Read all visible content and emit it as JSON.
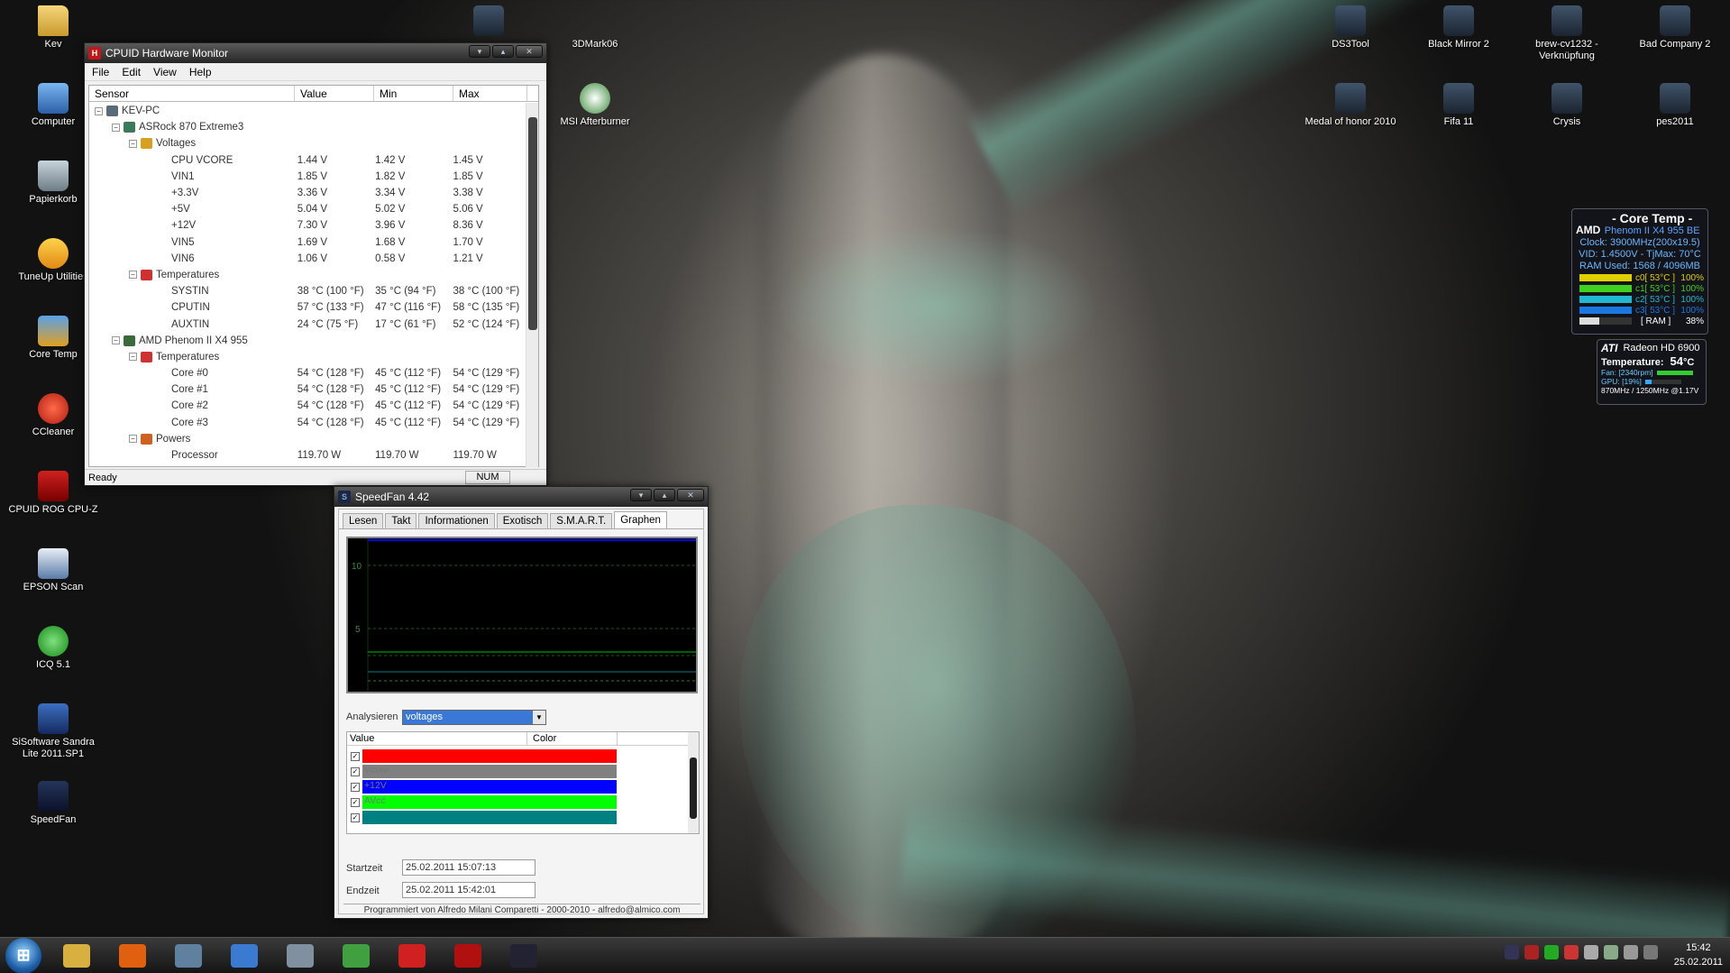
{
  "desktop": {
    "left_icons": [
      {
        "label": "Kev",
        "icon": "folder-icon"
      },
      {
        "label": "Computer",
        "icon": "computer-icon"
      },
      {
        "label": "Papierkorb",
        "icon": "recycle-bin-icon"
      },
      {
        "label": "TuneUp Utilities",
        "icon": "tuneup-icon"
      },
      {
        "label": "Core Temp",
        "icon": "coretemp-icon"
      },
      {
        "label": "CCleaner",
        "icon": "ccleaner-icon"
      },
      {
        "label": "CPUID ROG CPU-Z",
        "icon": "cpuz-icon"
      },
      {
        "label": "EPSON Scan",
        "icon": "epson-icon"
      },
      {
        "label": "ICQ 5.1",
        "icon": "icq-icon"
      },
      {
        "label": "SiSoftware Sandra Lite 2011.SP1",
        "icon": "sandra-icon"
      },
      {
        "label": "SpeedFan",
        "icon": "speedfan-icon"
      }
    ],
    "mid_icons": [
      {
        "label": "3DMark06",
        "icon": "3dmark-icon"
      },
      {
        "label": "MSI Afterburner",
        "icon": "afterburner-icon"
      }
    ],
    "right_icons": [
      {
        "label": "DS3Tool",
        "icon": "ds3tool-icon"
      },
      {
        "label": "Black Mirror 2",
        "icon": "game-icon"
      },
      {
        "label": "brew-cv1232 - Verknüpfung",
        "icon": "shortcut-icon"
      },
      {
        "label": "Bad Company 2",
        "icon": "game-icon"
      },
      {
        "label": "Medal of honor 2010",
        "icon": "game-icon"
      },
      {
        "label": "Fifa 11",
        "icon": "game-icon"
      },
      {
        "label": "Crysis",
        "icon": "game-icon"
      },
      {
        "label": "pes2011",
        "icon": "game-icon"
      }
    ]
  },
  "cpuid": {
    "title": "CPUID Hardware Monitor",
    "menu": [
      "File",
      "Edit",
      "View",
      "Help"
    ],
    "columns": [
      "Sensor",
      "Value",
      "Min",
      "Max"
    ],
    "rows": [
      {
        "indent": 0,
        "expander": "-",
        "label": "KEV-PC",
        "value": "",
        "min": "",
        "max": "",
        "kind": "pc"
      },
      {
        "indent": 1,
        "expander": "-",
        "label": "ASRock 870 Extreme3",
        "value": "",
        "min": "",
        "max": "",
        "kind": "board"
      },
      {
        "indent": 2,
        "expander": "-",
        "label": "Voltages",
        "value": "",
        "min": "",
        "max": "",
        "kind": "volt"
      },
      {
        "indent": 3,
        "expander": "",
        "label": "CPU VCORE",
        "value": "1.44 V",
        "min": "1.42 V",
        "max": "1.45 V"
      },
      {
        "indent": 3,
        "expander": "",
        "label": "VIN1",
        "value": "1.85 V",
        "min": "1.82 V",
        "max": "1.85 V"
      },
      {
        "indent": 3,
        "expander": "",
        "label": "+3.3V",
        "value": "3.36 V",
        "min": "3.34 V",
        "max": "3.38 V"
      },
      {
        "indent": 3,
        "expander": "",
        "label": "+5V",
        "value": "5.04 V",
        "min": "5.02 V",
        "max": "5.06 V"
      },
      {
        "indent": 3,
        "expander": "",
        "label": "+12V",
        "value": "7.30 V",
        "min": "3.96 V",
        "max": "8.36 V"
      },
      {
        "indent": 3,
        "expander": "",
        "label": "VIN5",
        "value": "1.69 V",
        "min": "1.68 V",
        "max": "1.70 V"
      },
      {
        "indent": 3,
        "expander": "",
        "label": "VIN6",
        "value": "1.06 V",
        "min": "0.58 V",
        "max": "1.21 V"
      },
      {
        "indent": 2,
        "expander": "-",
        "label": "Temperatures",
        "value": "",
        "min": "",
        "max": "",
        "kind": "temp"
      },
      {
        "indent": 3,
        "expander": "",
        "label": "SYSTIN",
        "value": "38 °C (100 °F)",
        "min": "35 °C (94 °F)",
        "max": "38 °C (100 °F)"
      },
      {
        "indent": 3,
        "expander": "",
        "label": "CPUTIN",
        "value": "57 °C (133 °F)",
        "min": "47 °C (116 °F)",
        "max": "58 °C (135 °F)"
      },
      {
        "indent": 3,
        "expander": "",
        "label": "AUXTIN",
        "value": "24 °C (75 °F)",
        "min": "17 °C (61 °F)",
        "max": "52 °C (124 °F)"
      },
      {
        "indent": 1,
        "expander": "-",
        "label": "AMD Phenom II X4 955",
        "value": "",
        "min": "",
        "max": "",
        "kind": "cpu"
      },
      {
        "indent": 2,
        "expander": "-",
        "label": "Temperatures",
        "value": "",
        "min": "",
        "max": "",
        "kind": "temp"
      },
      {
        "indent": 3,
        "expander": "",
        "label": "Core #0",
        "value": "54 °C (128 °F)",
        "min": "45 °C (112 °F)",
        "max": "54 °C (129 °F)"
      },
      {
        "indent": 3,
        "expander": "",
        "label": "Core #1",
        "value": "54 °C (128 °F)",
        "min": "45 °C (112 °F)",
        "max": "54 °C (129 °F)"
      },
      {
        "indent": 3,
        "expander": "",
        "label": "Core #2",
        "value": "54 °C (128 °F)",
        "min": "45 °C (112 °F)",
        "max": "54 °C (129 °F)"
      },
      {
        "indent": 3,
        "expander": "",
        "label": "Core #3",
        "value": "54 °C (128 °F)",
        "min": "45 °C (112 °F)",
        "max": "54 °C (129 °F)"
      },
      {
        "indent": 2,
        "expander": "-",
        "label": "Powers",
        "value": "",
        "min": "",
        "max": "",
        "kind": "power"
      },
      {
        "indent": 3,
        "expander": "",
        "label": "Processor",
        "value": "119.70 W",
        "min": "119.70 W",
        "max": "119.70 W"
      }
    ],
    "status": "Ready",
    "num_indicator": "NUM"
  },
  "speedfan": {
    "title": "SpeedFan 4.42",
    "tabs": [
      "Lesen",
      "Takt",
      "Informationen",
      "Exotisch",
      "S.M.A.R.T.",
      "Graphen"
    ],
    "active_tab": "Graphen",
    "graph_y_labels": [
      "10",
      "5"
    ],
    "analyze_label": "Analysieren",
    "analyze_value": "voltages",
    "list_columns": [
      "Value",
      "Color"
    ],
    "series": [
      {
        "name": "",
        "color": "#ff0000"
      },
      {
        "name": "Vcore",
        "color": "#808080"
      },
      {
        "name": "+12V",
        "color": "#0000ff"
      },
      {
        "name": "AVcc",
        "color": "#00ff00"
      },
      {
        "name": "",
        "color": "#008080"
      }
    ],
    "start_label": "Startzeit",
    "start_value": "25.02.2011 15:07:13",
    "end_label": "Endzeit",
    "end_value": "25.02.2011 15:42:01",
    "footer": "Programmiert von Alfredo Milani Comparetti - 2000-2010 - alfredo@almico.com"
  },
  "coretemp_gadget": {
    "title": "- Core Temp -",
    "brand": "AMD",
    "cpu": "Phenom II X4 955 BE",
    "clock": "Clock: 3900MHz(200x19.5)",
    "vid": "VID: 1.4500V - TjMax: 70°C",
    "ram": "RAM Used: 1568 / 4096MB",
    "cores": [
      {
        "label": "c0[ 53°C ]",
        "load": "100%",
        "color": "#e0d000"
      },
      {
        "label": "c1[ 53°C ]",
        "load": "100%",
        "color": "#40d020"
      },
      {
        "label": "c2[ 53°C ]",
        "load": "100%",
        "color": "#20b8d0"
      },
      {
        "label": "c3[ 53°C ]",
        "load": "100%",
        "color": "#1a78e0"
      }
    ],
    "ram_label": "[ RAM ]",
    "ram_pct": "38%",
    "ram_fraction": 0.38
  },
  "ati_gadget": {
    "brand": "ATI",
    "model": "Radeon HD 6900",
    "temp_label": "Temperature:",
    "temp_value": "54",
    "temp_unit": "°C",
    "fan": "Fan: [2340rpm]",
    "gpu": "GPU: [19%]",
    "clocks": "870MHz / 1250MHz @1.17V"
  },
  "taskbar": {
    "apps": [
      {
        "name": "explorer",
        "color": "#d8b040"
      },
      {
        "name": "firefox",
        "color": "#e06010"
      },
      {
        "name": "monitor",
        "color": "#6080a0"
      },
      {
        "name": "thunderbird",
        "color": "#3a7ad0"
      },
      {
        "name": "speedfan-gear",
        "color": "#8090a0"
      },
      {
        "name": "messenger",
        "color": "#40a040"
      },
      {
        "name": "flash",
        "color": "#d02020"
      },
      {
        "name": "cpuz",
        "color": "#b01010"
      },
      {
        "name": "dark-app",
        "color": "#223"
      }
    ],
    "time": "15:42",
    "date": "25.02.2011"
  }
}
